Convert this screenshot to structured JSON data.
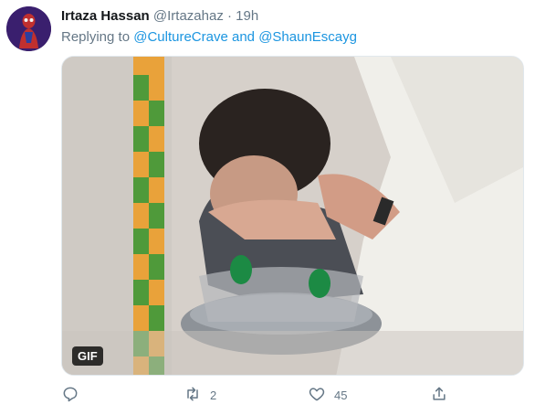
{
  "tweet": {
    "author_name": "Irtaza Hassan",
    "author_handle": "@Irtazahaz",
    "separator": "·",
    "time": "19h",
    "replying_prefix": "Replying to",
    "mention_1": "@CultureCrave",
    "conjunction": "and",
    "mention_2": "@ShaunEscayg",
    "media_badge": "GIF",
    "retweet_count": "2",
    "like_count": "45"
  },
  "icons": {
    "reply": "reply-icon",
    "retweet": "retweet-icon",
    "like": "heart-icon",
    "share": "share-icon"
  },
  "colors": {
    "link": "#1b95e0",
    "secondary_text": "#657786",
    "primary_text": "#14171a"
  }
}
